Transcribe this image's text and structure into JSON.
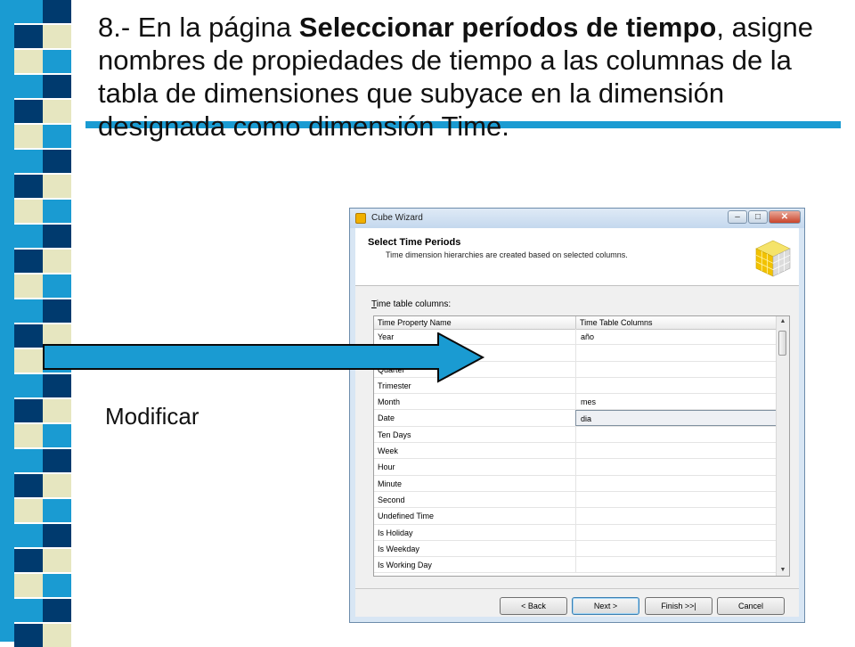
{
  "slide": {
    "number": "8.- ",
    "pre": "En la página ",
    "bold": "Seleccionar períodos de tiempo",
    "post": ", asigne nombres de propiedades de tiempo a las columnas de la tabla de dimensiones que subyace en la dimensión designada como dimensión Time.",
    "annotation": "Modificar"
  },
  "colors": {
    "strip_blue": "#1a9bd2",
    "strip_navy": "#003a6e",
    "strip_cream": "#e6e6c0",
    "arrow": "#1a9bd2"
  },
  "dialog": {
    "title": "Cube Wizard",
    "window_buttons": [
      "–",
      "□",
      "✕"
    ],
    "header_title": "Select Time Periods",
    "header_subtitle": "Time dimension hierarchies are created based on selected columns.",
    "table_label_key": "T",
    "table_label_rest": "ime table columns:",
    "columns": [
      "Time Property Name",
      "Time Table Columns"
    ],
    "rows": [
      {
        "name": "Year",
        "value": "año"
      },
      {
        "name": "",
        "value": ""
      },
      {
        "name": "Quarter",
        "value": ""
      },
      {
        "name": "Trimester",
        "value": ""
      },
      {
        "name": "Month",
        "value": "mes"
      },
      {
        "name": "Date",
        "value": "dia"
      },
      {
        "name": "Ten Days",
        "value": ""
      },
      {
        "name": "Week",
        "value": ""
      },
      {
        "name": "Hour",
        "value": ""
      },
      {
        "name": "Minute",
        "value": ""
      },
      {
        "name": "Second",
        "value": ""
      },
      {
        "name": "Undefined Time",
        "value": ""
      },
      {
        "name": "Is Holiday",
        "value": ""
      },
      {
        "name": "Is Weekday",
        "value": ""
      },
      {
        "name": "Is Working Day",
        "value": ""
      }
    ],
    "selected_row_index": 5,
    "buttons": {
      "back": "< Back",
      "next": "Next >",
      "finish": "Finish >>|",
      "cancel": "Cancel"
    }
  }
}
